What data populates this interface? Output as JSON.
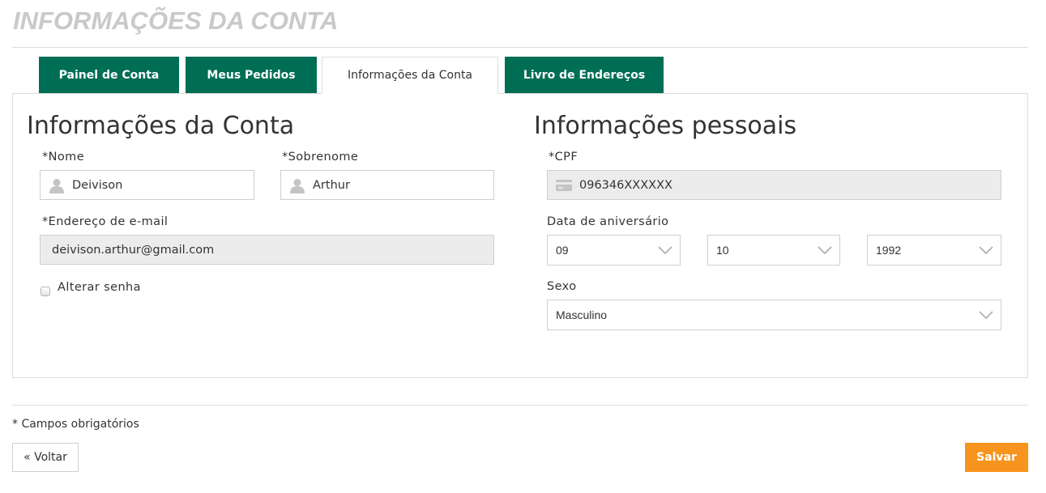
{
  "page": {
    "title": "INFORMAÇÕES DA CONTA"
  },
  "tabs": [
    {
      "label": "Painel de Conta",
      "active": false
    },
    {
      "label": "Meus Pedidos",
      "active": false
    },
    {
      "label": "Informações da Conta",
      "active": true
    },
    {
      "label": "Livro de Endereços",
      "active": false
    }
  ],
  "account": {
    "heading": "Informações da Conta",
    "first_name": {
      "label": "*Nome",
      "value": "Deivison",
      "icon": "user-icon"
    },
    "last_name": {
      "label": "*Sobrenome",
      "value": "Arthur",
      "icon": "user-icon"
    },
    "email": {
      "label": "*Endereço de e-mail",
      "value": "deivison.arthur@gmail.com"
    },
    "change_password": {
      "label": "Alterar senha",
      "checked": false
    }
  },
  "personal": {
    "heading": "Informações pessoais",
    "cpf": {
      "label": "*CPF",
      "value": "096346XXXXXX",
      "icon": "card-icon"
    },
    "birthday": {
      "label": "Data de aniversário",
      "day": "09",
      "month": "10",
      "year": "1992"
    },
    "gender": {
      "label": "Sexo",
      "value": "Masculino"
    }
  },
  "footer": {
    "required_note": "* Campos obrigatórios",
    "back_label": "« Voltar",
    "save_label": "Salvar"
  },
  "colors": {
    "tab_green": "#006e54",
    "save_orange": "#f7941d",
    "title_gray": "#c9c9c9",
    "readonly_bg": "#ececec"
  }
}
